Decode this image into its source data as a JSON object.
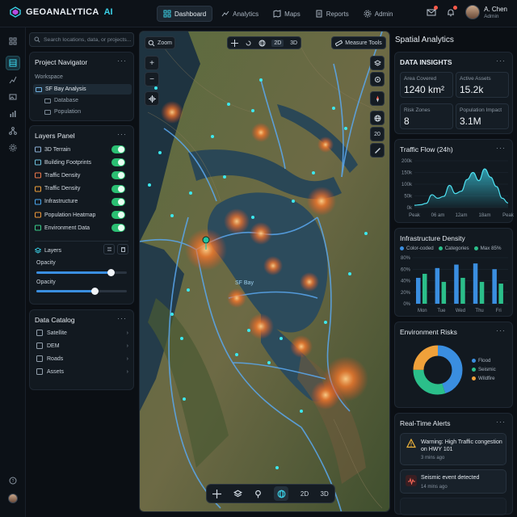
{
  "app": {
    "brand": "GEOANALYTICA",
    "brand_ai": "AI"
  },
  "nav": [
    {
      "label": "Dashboard",
      "icon": "dashboard-icon",
      "active": true
    },
    {
      "label": "Analytics",
      "icon": "analytics-icon"
    },
    {
      "label": "Maps",
      "icon": "map-icon"
    },
    {
      "label": "Reports",
      "icon": "reports-icon"
    },
    {
      "label": "Admin",
      "icon": "gear-icon"
    }
  ],
  "user": {
    "name": "A. Chen",
    "role": "Admin"
  },
  "search": {
    "placeholder": "Search locations, data, or projects..."
  },
  "navigator": {
    "title": "Project Navigator",
    "workspace_label": "Workspace",
    "project": "SF Bay Analysis",
    "children": [
      "Database",
      "Population"
    ]
  },
  "layers_panel": {
    "title": "Layers Panel",
    "items": [
      {
        "label": "3D Terrain",
        "color": "#8fb3d9"
      },
      {
        "label": "Building Footprints",
        "color": "#6fc3e0"
      },
      {
        "label": "Traffic Density",
        "color": "#f07a4a"
      },
      {
        "label": "Traffic Density",
        "color": "#f0a13a"
      },
      {
        "label": "Infrastructure",
        "color": "#4aa8f0"
      },
      {
        "label": "Population Heatmap",
        "color": "#f09a3a"
      },
      {
        "label": "Environment Data",
        "color": "#3ad08a"
      }
    ],
    "layers_label": "Layers",
    "opacity_label": "Opacity",
    "opacity_values": [
      0.82,
      0.64
    ]
  },
  "catalog": {
    "title": "Data Catalog",
    "items": [
      {
        "label": "Satellite",
        "icon": "satellite-icon"
      },
      {
        "label": "DEM",
        "icon": "dem-icon"
      },
      {
        "label": "Roads",
        "icon": "roads-icon"
      },
      {
        "label": "Assets",
        "icon": "assets-icon"
      }
    ]
  },
  "map": {
    "zoom_label": "Zoom",
    "mode_2d": "2D",
    "mode_3d": "3D",
    "measure_label": "Measure Tools",
    "bay_label": "SF Bay",
    "side_20": "20",
    "bottom_2d": "2D",
    "bottom_3d": "3D"
  },
  "right": {
    "title": "Spatial Analytics",
    "insights": {
      "title": "DATA INSIGHTS",
      "kpis": [
        {
          "label": "Area Covered",
          "value": "1240 km²"
        },
        {
          "label": "Active Assets",
          "value": "15.2k"
        },
        {
          "label": "Risk Zones",
          "value": "8"
        },
        {
          "label": "Population Impact",
          "value": "3.1M"
        }
      ]
    }
  },
  "traffic": {
    "title": "Traffic Flow (24h)",
    "yticks": [
      "200k",
      "150k",
      "100k",
      "50k",
      "0k"
    ],
    "xticks": [
      "Peak",
      "06 am",
      "12am",
      "18am",
      "Peak"
    ]
  },
  "infra": {
    "title": "Infrastructure Density",
    "legend": [
      "Color-coded",
      "Categories",
      "Max 85%"
    ],
    "yticks": [
      "80%",
      "60%",
      "40%",
      "20%",
      "0%"
    ],
    "days": [
      "Mon",
      "Tue",
      "Wed",
      "Thu",
      "Fri"
    ]
  },
  "env": {
    "title": "Environment Risks",
    "legend": [
      "Flood",
      "Seismic",
      "Wildfire"
    ],
    "colors": [
      "#3a8ee0",
      "#2bbf8a",
      "#f0a13a"
    ]
  },
  "alerts": {
    "title": "Real-Time Alerts",
    "items": [
      {
        "text": "Warning: High Traffic congestion on HWY 101",
        "time": "3 mins ago"
      },
      {
        "text": "Seismic event detected",
        "time": "14 mins ago"
      }
    ]
  },
  "chart_data": [
    {
      "type": "area",
      "title": "Traffic Flow (24h)",
      "x": [
        0,
        1,
        2,
        3,
        4,
        5,
        6,
        7,
        8,
        9,
        10,
        11,
        12,
        13,
        14,
        15,
        16
      ],
      "xticks": [
        "Peak",
        "06 am",
        "12am",
        "18am",
        "Peak"
      ],
      "values": [
        10,
        12,
        18,
        55,
        40,
        48,
        95,
        60,
        70,
        120,
        150,
        115,
        165,
        130,
        90,
        40,
        20
      ],
      "ylim": [
        0,
        200
      ],
      "unit": "k"
    },
    {
      "type": "bar",
      "title": "Infrastructure Density",
      "categories": [
        "Mon",
        "Tue",
        "Wed",
        "Thu",
        "Fri"
      ],
      "series": [
        {
          "name": "Color-coded",
          "values": [
            45,
            62,
            68,
            70,
            60
          ]
        },
        {
          "name": "Categories",
          "values": [
            52,
            38,
            45,
            38,
            35
          ]
        }
      ],
      "ylim": [
        0,
        85
      ]
    },
    {
      "type": "pie",
      "title": "Environment Risks",
      "categories": [
        "Flood",
        "Seismic",
        "Wildfire"
      ],
      "values": [
        45,
        30,
        25
      ]
    }
  ]
}
